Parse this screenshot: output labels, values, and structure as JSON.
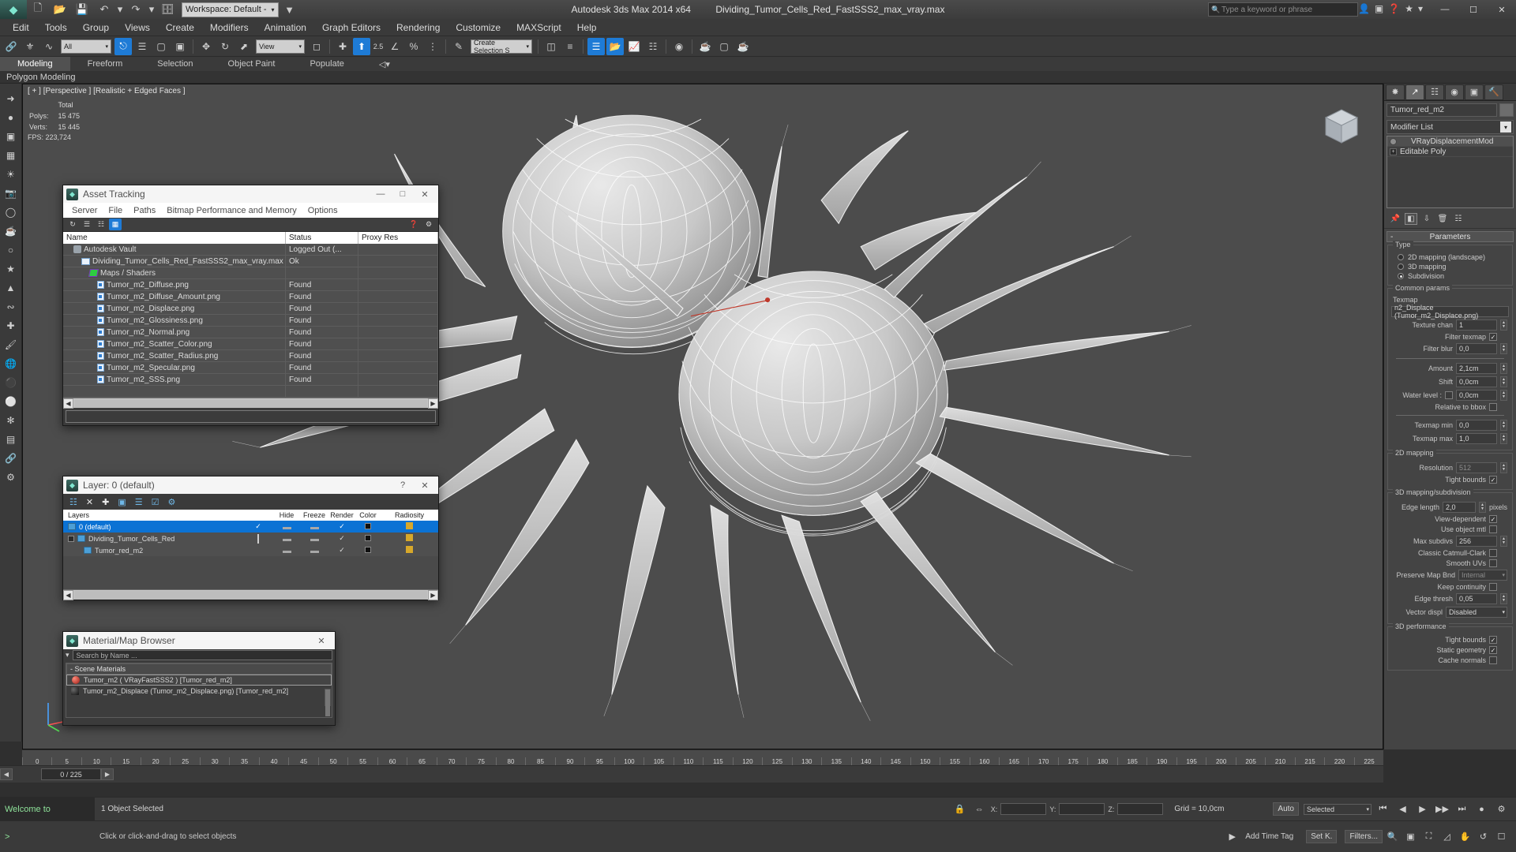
{
  "titlebar": {
    "app_title": "Autodesk 3ds Max  2014 x64",
    "file_title": "Dividing_Tumor_Cells_Red_FastSSS2_max_vray.max",
    "workspace_label": "Workspace: Default -",
    "search_placeholder": "Type a keyword or phrase",
    "min": "—",
    "max": "☐",
    "close": "✕"
  },
  "menu": {
    "items": [
      "Edit",
      "Tools",
      "Group",
      "Views",
      "Create",
      "Modifiers",
      "Animation",
      "Graph Editors",
      "Rendering",
      "Customize",
      "MAXScript",
      "Help"
    ]
  },
  "toolbar": {
    "selection_filter": "All",
    "ref_coord_system": "View",
    "named_selection_sets": "Create Selection S",
    "percent_snap": "2.5"
  },
  "ribbon": {
    "tabs": [
      "Modeling",
      "Freeform",
      "Selection",
      "Object Paint",
      "Populate"
    ],
    "subtitle": "Polygon Modeling"
  },
  "viewport": {
    "label": "[ + ] [Perspective ] [Realistic + Edged Faces ]",
    "stats_header": "Total",
    "polys_label": "Polys:",
    "polys_value": "15 475",
    "verts_label": "Verts:",
    "verts_value": "15 445",
    "fps_label": "FPS:",
    "fps_value": "223,724"
  },
  "asset_tracking": {
    "title": "Asset Tracking",
    "menu": [
      "Server",
      "File",
      "Paths",
      "Bitmap Performance and Memory",
      "Options"
    ],
    "columns": [
      "Name",
      "Status",
      "Proxy Res"
    ],
    "rows": [
      {
        "name": "Autodesk Vault",
        "status": "Logged Out (...",
        "icon": "vault-icon",
        "indent": 1
      },
      {
        "name": "Dividing_Tumor_Cells_Red_FastSSS2_max_vray.max",
        "status": "Ok",
        "icon": "max-file-icon",
        "indent": 2
      },
      {
        "name": "Maps / Shaders",
        "status": "",
        "icon": "maps-icon",
        "indent": 3
      },
      {
        "name": "Tumor_m2_Diffuse.png",
        "status": "Found",
        "icon": "bitmap-icon",
        "indent": 4
      },
      {
        "name": "Tumor_m2_Diffuse_Amount.png",
        "status": "Found",
        "icon": "bitmap-icon",
        "indent": 4
      },
      {
        "name": "Tumor_m2_Displace.png",
        "status": "Found",
        "icon": "bitmap-icon",
        "indent": 4
      },
      {
        "name": "Tumor_m2_Glossiness.png",
        "status": "Found",
        "icon": "bitmap-icon",
        "indent": 4
      },
      {
        "name": "Tumor_m2_Normal.png",
        "status": "Found",
        "icon": "bitmap-icon",
        "indent": 4
      },
      {
        "name": "Tumor_m2_Scatter_Color.png",
        "status": "Found",
        "icon": "bitmap-icon",
        "indent": 4
      },
      {
        "name": "Tumor_m2_Scatter_Radius.png",
        "status": "Found",
        "icon": "bitmap-icon",
        "indent": 4
      },
      {
        "name": "Tumor_m2_Specular.png",
        "status": "Found",
        "icon": "bitmap-icon",
        "indent": 4
      },
      {
        "name": "Tumor_m2_SSS.png",
        "status": "Found",
        "icon": "bitmap-icon",
        "indent": 4
      }
    ]
  },
  "layer_dialog": {
    "title": "Layer: 0 (default)",
    "columns": [
      "Layers",
      "Hide",
      "Freeze",
      "Render",
      "Color",
      "Radiosity"
    ],
    "rows": [
      {
        "name": "0 (default)",
        "selected": true,
        "current": "check",
        "indent": 1
      },
      {
        "name": "Dividing_Tumor_Cells_Red",
        "selected": false,
        "current": "box",
        "indent": 1
      },
      {
        "name": "Tumor_red_m2",
        "selected": false,
        "current": "",
        "indent": 2
      }
    ],
    "help_glyph": "?",
    "close_glyph": "✕"
  },
  "material_browser": {
    "title": "Material/Map Browser",
    "search_placeholder": "Search by Name ...",
    "group_label": "- Scene Materials",
    "items": [
      {
        "label": "Tumor_m2  ( VRayFastSSS2 )  [Tumor_red_m2]",
        "selected": true,
        "swatch": "red"
      },
      {
        "label": "Tumor_m2_Displace (Tumor_m2_Displace.png)  [Tumor_red_m2]",
        "selected": false,
        "swatch": "dark"
      }
    ],
    "close_glyph": "✕"
  },
  "command_panel": {
    "tabs": [
      "create-tab",
      "modify-tab",
      "hierarchy-tab",
      "motion-tab",
      "display-tab",
      "utilities-tab"
    ],
    "object_name": "Tumor_red_m2",
    "modifier_list_label": "Modifier List",
    "stack": [
      {
        "label": "VRayDisplacementMod",
        "selected": true
      },
      {
        "label": "Editable Poly",
        "selected": false
      }
    ],
    "rollout_title": "Parameters",
    "type_legend": "Type",
    "type_options": [
      {
        "label": "2D mapping (landscape)",
        "on": false
      },
      {
        "label": "3D mapping",
        "on": false
      },
      {
        "label": "Subdivision",
        "on": true
      }
    ],
    "common_params": {
      "legend": "Common params",
      "texmap_label": "Texmap",
      "texmap_value": "n2_Displace (Tumor_m2_Displace.png)",
      "texture_chan_label": "Texture chan",
      "texture_chan_value": "1",
      "filter_texmap_label": "Filter texmap",
      "filter_texmap_checked": true,
      "filter_blur_label": "Filter blur",
      "filter_blur_value": "0,0",
      "amount_label": "Amount",
      "amount_value": "2,1cm",
      "shift_label": "Shift",
      "shift_value": "0,0cm",
      "water_level_label": "Water level :",
      "water_level_checked": false,
      "water_level_value": "0,0cm",
      "relative_bbox_label": "Relative to bbox",
      "relative_bbox_checked": false,
      "texmap_min_label": "Texmap min",
      "texmap_min_value": "0,0",
      "texmap_max_label": "Texmap max",
      "texmap_max_value": "1,0"
    },
    "mapping_2d": {
      "legend": "2D mapping",
      "resolution_label": "Resolution",
      "resolution_value": "512",
      "tight_bounds_label": "Tight bounds",
      "tight_bounds_checked": true
    },
    "mapping_3d": {
      "legend": "3D mapping/subdivision",
      "edge_length_label": "Edge length",
      "edge_length_value": "2,0",
      "edge_length_units": "pixels",
      "view_dependent_label": "View-dependent",
      "view_dependent_checked": true,
      "use_object_mtl_label": "Use object mtl",
      "use_object_mtl_checked": false,
      "max_subdivs_label": "Max subdivs",
      "max_subdivs_value": "256",
      "classic_catmull_label": "Classic Catmull-Clark",
      "classic_catmull_checked": false,
      "smooth_uvs_label": "Smooth UVs",
      "smooth_uvs_checked": false,
      "preserve_map_label": "Preserve Map Bnd",
      "preserve_map_value": "Internal",
      "keep_continuity_label": "Keep continuity",
      "keep_continuity_checked": false,
      "edge_thresh_label": "Edge thresh",
      "edge_thresh_value": "0,05",
      "vector_displ_label": "Vector displ",
      "vector_displ_value": "Disabled"
    },
    "performance_3d": {
      "legend": "3D performance",
      "tight_bounds_label": "Tight bounds",
      "tight_bounds_checked": true,
      "static_geometry_label": "Static geometry",
      "static_geometry_checked": true,
      "cache_normals_label": "Cache normals",
      "cache_normals_checked": false
    }
  },
  "timeline": {
    "ticks": [
      "0",
      "5",
      "10",
      "15",
      "20",
      "25",
      "30",
      "35",
      "40",
      "45",
      "50",
      "55",
      "60",
      "65",
      "70",
      "75",
      "80",
      "85",
      "90",
      "95",
      "100",
      "105",
      "110",
      "115",
      "120",
      "125",
      "130",
      "135",
      "140",
      "145",
      "150",
      "155",
      "160",
      "165",
      "170",
      "175",
      "180",
      "185",
      "190",
      "195",
      "200",
      "205",
      "210",
      "215",
      "220",
      "225"
    ],
    "frame_field": "0 / 225"
  },
  "statusbar": {
    "welcome": "Welcome to",
    "selection_info": "1 Object Selected",
    "prompt": "Click or click-and-drag to select objects",
    "x_label": "X:",
    "x_value": "",
    "y_label": "Y:",
    "y_value": "",
    "z_label": "Z:",
    "z_value": "",
    "grid_label": "Grid = 10,0cm",
    "add_time_tag": "Add Time Tag",
    "auto_label": "Auto",
    "selected_label": "Selected",
    "set_key_label": "Set K.",
    "filters_label": "Filters..."
  }
}
